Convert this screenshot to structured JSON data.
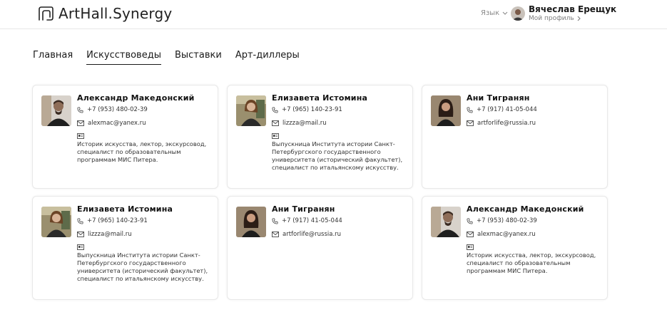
{
  "header": {
    "logo_text": "ArtHall.Synergy",
    "language_label": "Язык",
    "user_name": "Вячеслав Ерещук",
    "profile_link": "Мой профиль"
  },
  "nav": {
    "items": [
      {
        "label": "Главная",
        "active": false
      },
      {
        "label": "Искусствоведы",
        "active": true
      },
      {
        "label": "Выставки",
        "active": false
      },
      {
        "label": "Арт-диллеры",
        "active": false
      }
    ]
  },
  "cards": [
    {
      "name": "Александр Македонский",
      "phone": "+7 (953) 480-02-39",
      "email": "alexmac@yanex.ru",
      "bio": "Историк искусства, лектор, экскурсовод, специалист по образовательным программам МИС Питера."
    },
    {
      "name": "Елизавета Истомина",
      "phone": "+7 (965) 140-23-91",
      "email": "lizzza@mail.ru",
      "bio": "Выпускница Института истории Санкт-Петербургского государственного университета (исторический факультет), специалист по итальянскому искусству."
    },
    {
      "name": "Ани Тигранян",
      "phone": "+7 (917) 41-05-044",
      "email": "artforlife@russia.ru",
      "bio": ""
    },
    {
      "name": "Елизавета Истомина",
      "phone": "+7 (965) 140-23-91",
      "email": "lizzza@mail.ru",
      "bio": "Выпускница Института истории Санкт-Петербургского государственного университета (исторический факультет), специалист по итальянскому искусству."
    },
    {
      "name": "Ани Тигранян",
      "phone": "+7 (917) 41-05-044",
      "email": "artforlife@russia.ru",
      "bio": ""
    },
    {
      "name": "Александр Македонский",
      "phone": "+7 (953) 480-02-39",
      "email": "alexmac@yanex.ru",
      "bio": "Историк искусства, лектор, экскурсовод, специалист по образовательным программам МИС Питера."
    }
  ],
  "icons": {
    "logo": "arthall-logo-icon",
    "language": "chevron-down-icon",
    "profile": "chevron-right-icon",
    "phone": "phone-icon",
    "email": "mail-icon",
    "bio": "id-card-icon"
  },
  "colors": {
    "text": "#1a1a1a",
    "muted": "#8a8a8a",
    "border": "#e8e8e8"
  }
}
